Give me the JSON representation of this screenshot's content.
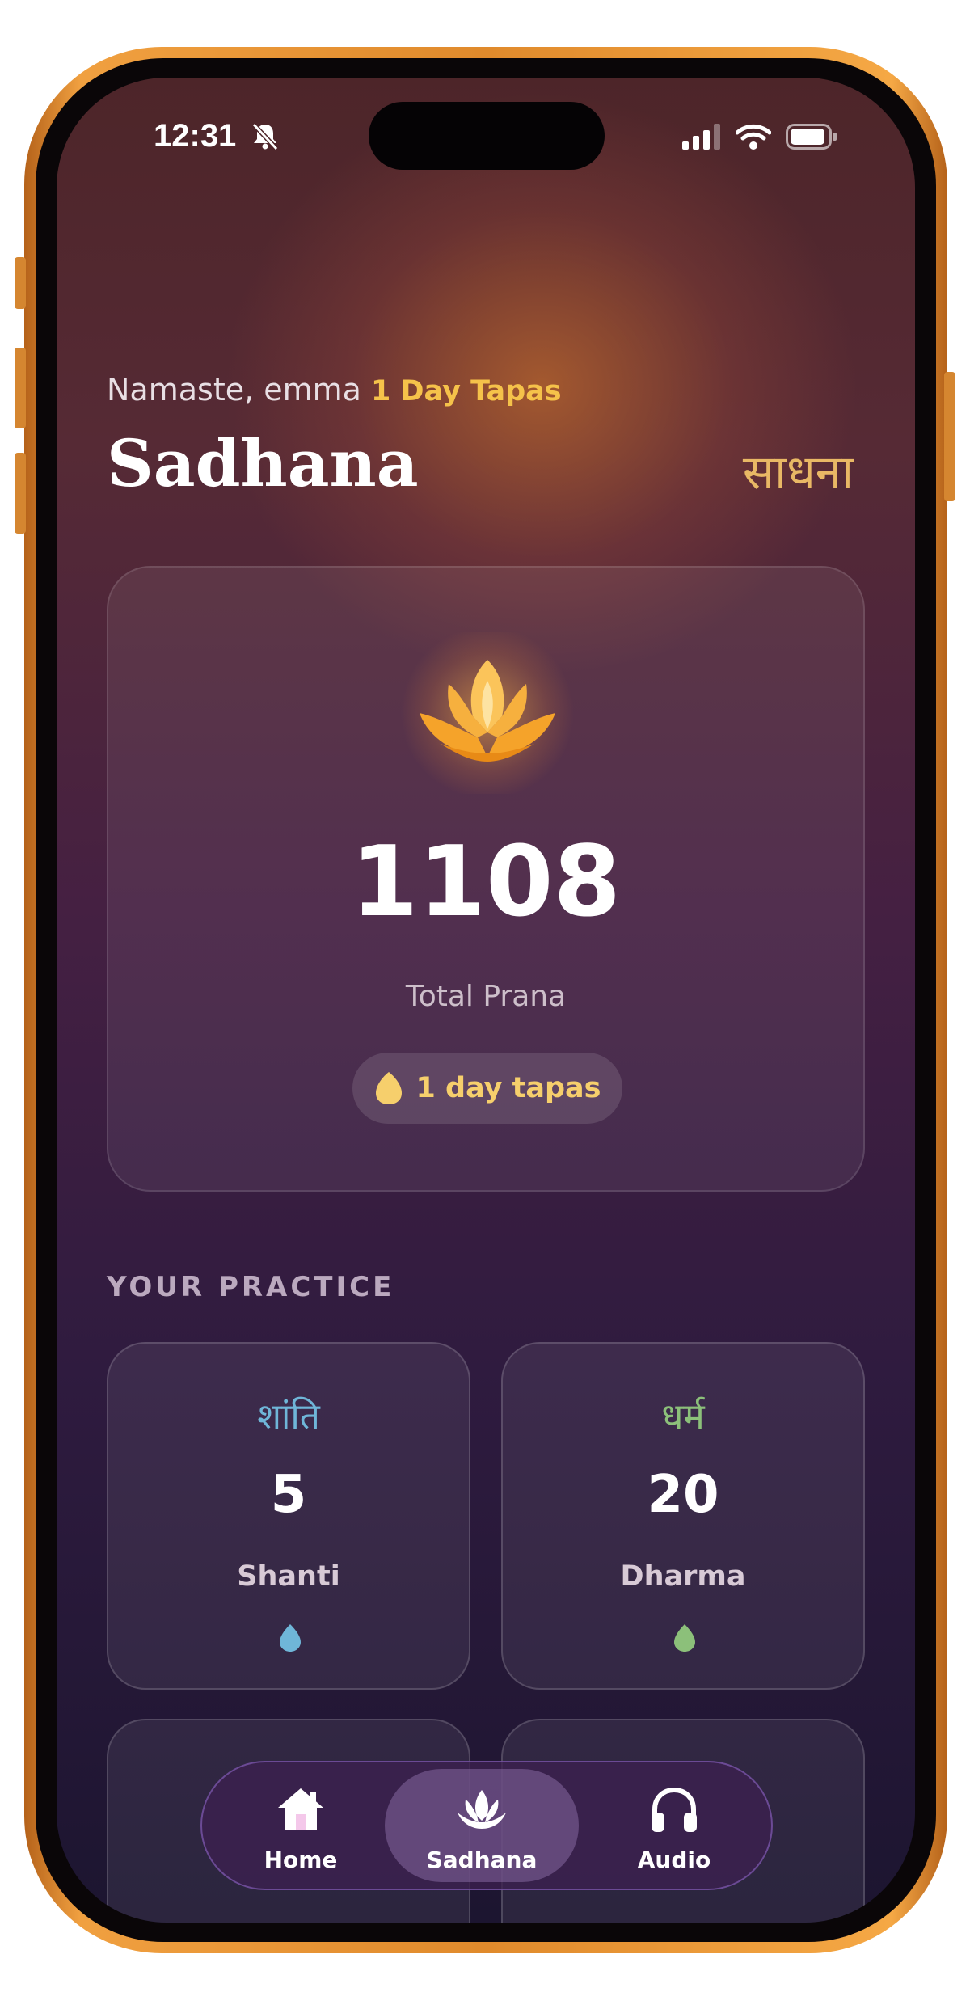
{
  "status_bar": {
    "time": "12:31"
  },
  "header": {
    "greeting": "Namaste, emma",
    "streak": "1 Day Tapas",
    "title": "Sadhana",
    "title_hindi": "साधना"
  },
  "hero": {
    "total": "1108",
    "label": "Total Prana",
    "tapas": "1 day tapas"
  },
  "practice": {
    "heading": "YOUR PRACTICE",
    "cards": [
      {
        "hindi": "शांति",
        "value": "5",
        "name": "Shanti",
        "color": "#6fb6d8"
      },
      {
        "hindi": "धर्म",
        "value": "20",
        "name": "Dharma",
        "color": "#8cc07a"
      }
    ]
  },
  "nav": {
    "items": [
      {
        "label": "Home",
        "icon": "home-icon"
      },
      {
        "label": "Sadhana",
        "icon": "lotus-icon",
        "active": true
      },
      {
        "label": "Audio",
        "icon": "headphones-icon"
      }
    ]
  },
  "colors": {
    "accent_gold": "#f5c24a",
    "frame_orange": "#e08a2c"
  }
}
